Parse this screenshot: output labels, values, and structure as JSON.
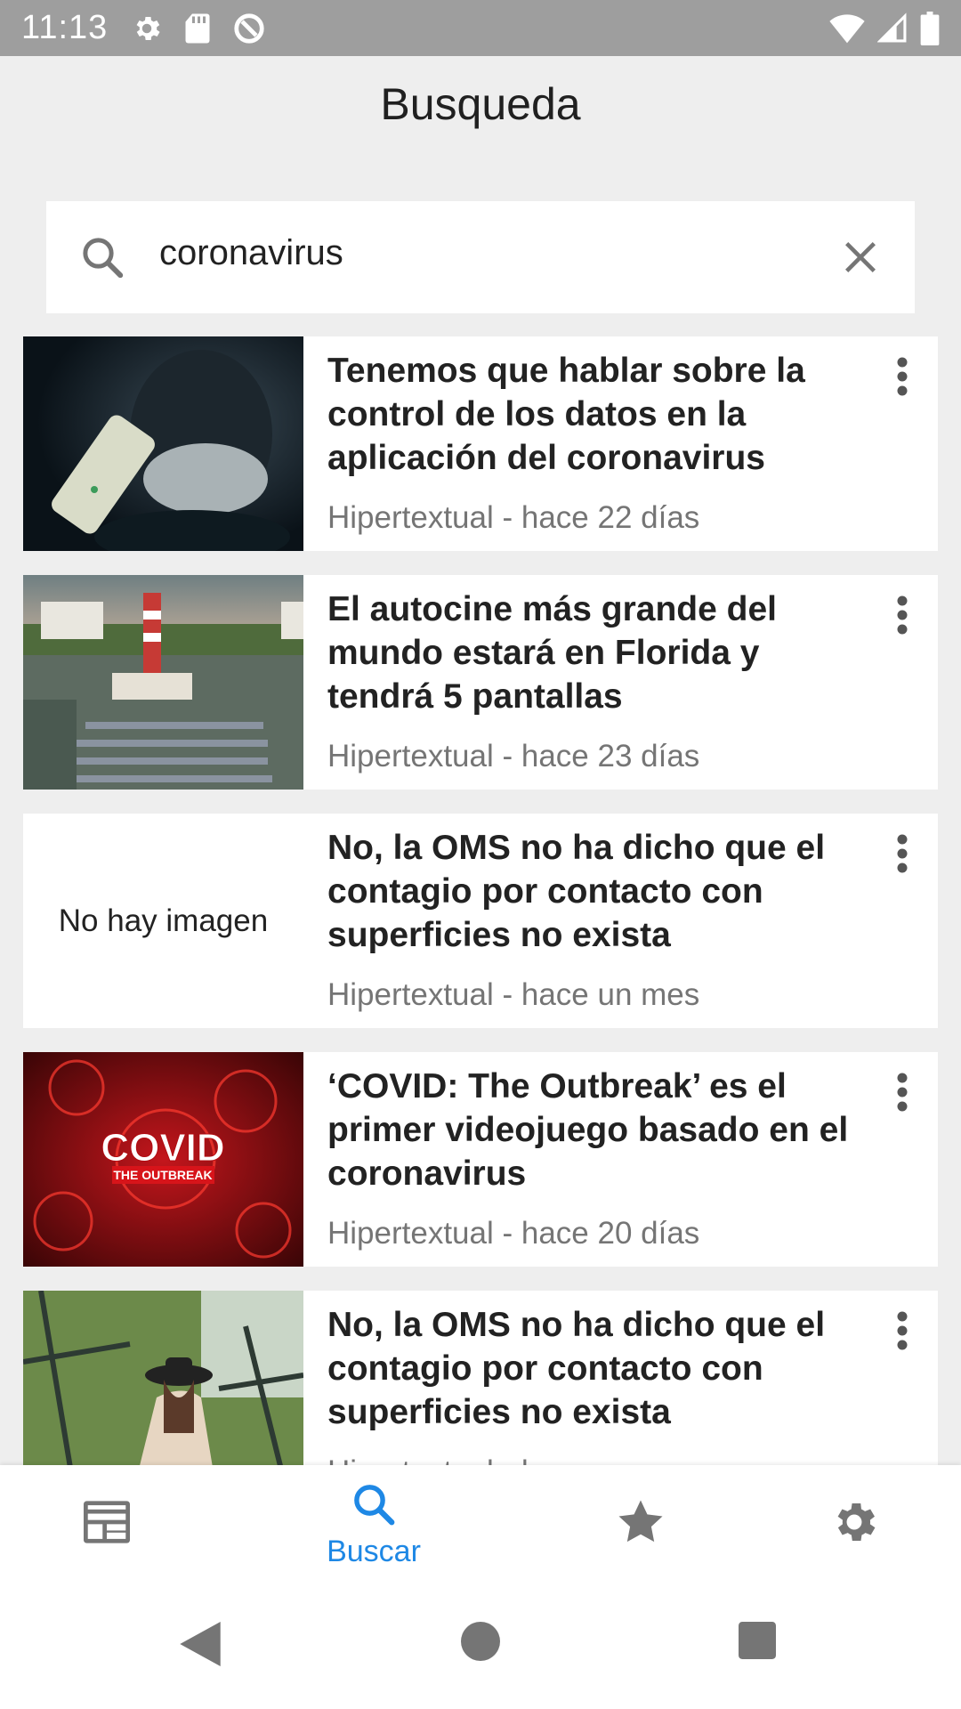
{
  "status_bar": {
    "time": "11:13",
    "icons_left": [
      "settings-icon",
      "sd-card-icon",
      "data-saver-icon"
    ],
    "icons_right": [
      "wifi-icon",
      "signal-icon",
      "battery-icon"
    ]
  },
  "header": {
    "title": "Busqueda"
  },
  "search": {
    "value": "coronavirus",
    "search_icon": "search-icon",
    "clear_icon": "close-icon"
  },
  "results": [
    {
      "title": "Tenemos que hablar sobre la control de los datos en la aplicación del coronavirus",
      "meta": "Hipertextual - hace 22 días",
      "image": "person-mask-phone"
    },
    {
      "title": "El autocine más grande del mundo estará en Florida y tendrá 5 pantallas",
      "meta": "Hipertextual - hace 23 días",
      "image": "drive-in-lighthouse"
    },
    {
      "title": "No, la OMS no ha dicho que el contagio por contacto con superficies no exista",
      "meta": "Hipertextual - hace un mes",
      "no_image_text": "No hay imagen"
    },
    {
      "title": "‘COVID: The Outbreak’ es el primer videojuego basado en el coronavirus",
      "meta": "Hipertextual - hace 20 días",
      "image": "covid-outbreak-logo",
      "image_text_1": "COVID",
      "image_text_2": "THE OUTBREAK"
    },
    {
      "title": "No, la OMS no ha dicho que el contagio por contacto con superficies no exista",
      "meta": "Hipertextual - hace",
      "image": "woman-hat-stairs"
    }
  ],
  "bottom_nav": {
    "items": [
      {
        "icon": "news-icon",
        "label": ""
      },
      {
        "icon": "search-icon",
        "label": "Buscar",
        "active": true
      },
      {
        "icon": "star-icon",
        "label": ""
      },
      {
        "icon": "gear-icon",
        "label": ""
      }
    ],
    "active_color": "#1e88e5",
    "inactive_color": "#757575"
  },
  "system_nav": [
    "back-icon",
    "home-icon",
    "recents-icon"
  ]
}
